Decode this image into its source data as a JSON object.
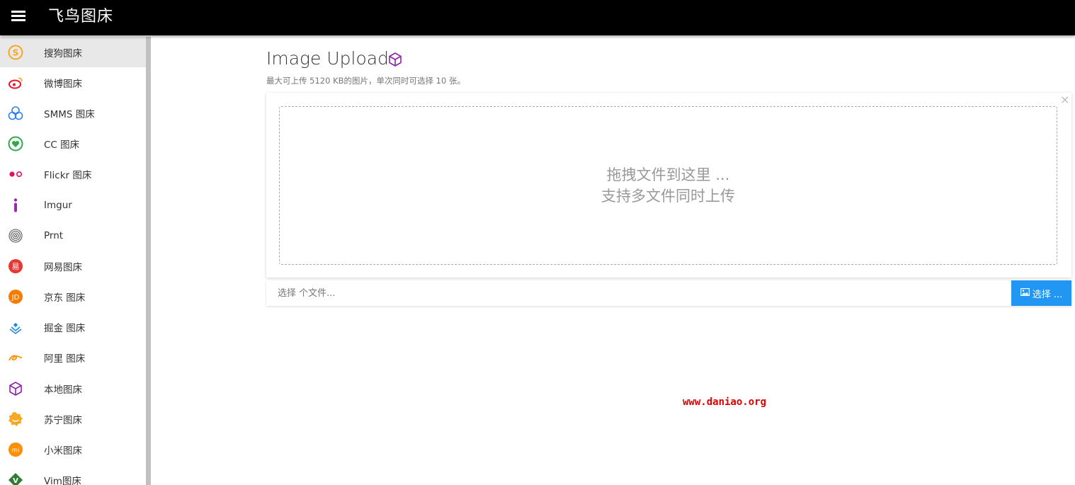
{
  "app": {
    "title": "飞鸟图床"
  },
  "sidebar": {
    "items": [
      {
        "label": "搜狗图床",
        "icon": "sogou-icon",
        "active": true
      },
      {
        "label": "微博图床",
        "icon": "weibo-icon"
      },
      {
        "label": "SMMS 图床",
        "icon": "smms-icon"
      },
      {
        "label": "CC 图床",
        "icon": "cc-heart-icon"
      },
      {
        "label": "Flickr 图床",
        "icon": "flickr-icon"
      },
      {
        "label": "Imgur",
        "icon": "imgur-icon"
      },
      {
        "label": "Prnt",
        "icon": "fingerprint-icon"
      },
      {
        "label": "网易图床",
        "icon": "netease-icon"
      },
      {
        "label": "京东 图床",
        "icon": "jd-icon"
      },
      {
        "label": "掘金 图床",
        "icon": "juejin-icon"
      },
      {
        "label": "阿里 图床",
        "icon": "alibaba-icon"
      },
      {
        "label": "本地图床",
        "icon": "cube-icon"
      },
      {
        "label": "苏宁图床",
        "icon": "suning-icon"
      },
      {
        "label": "小米图床",
        "icon": "xiaomi-icon"
      },
      {
        "label": "Vim图床",
        "icon": "vim-icon"
      }
    ]
  },
  "main": {
    "title": "Image Upload",
    "subtitle": "最大可上传 5120 KB的图片，单次同时可选择 10 张。",
    "close": "×",
    "drop_line1": "拖拽文件到这里 ...",
    "drop_line2": "支持多文件同时上传",
    "file_placeholder": "选择 个文件...",
    "choose_label": "选择 ..."
  },
  "watermark": "www.daniao.org",
  "colors": {
    "accent": "#2196f3",
    "topbar": "#000000",
    "watermark": "#e00000"
  }
}
